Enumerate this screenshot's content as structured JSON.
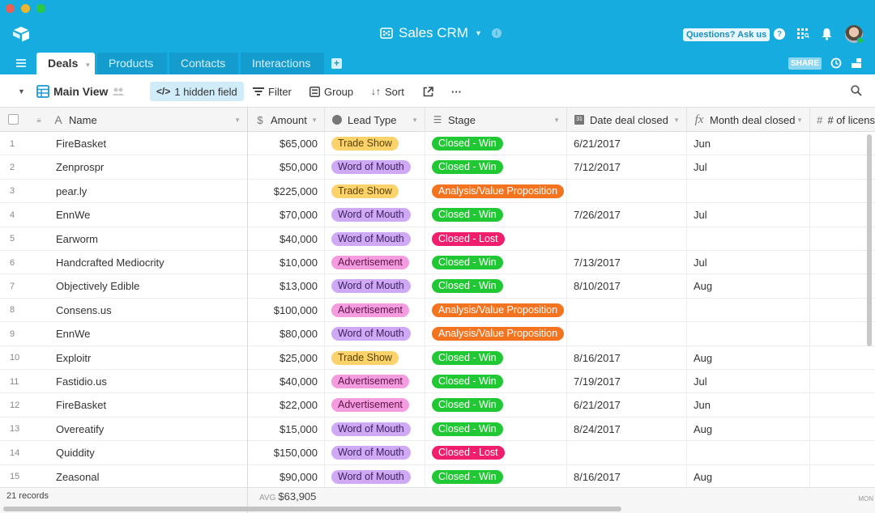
{
  "app": {
    "base_title": "Sales CRM",
    "help_button": "Questions? Ask us",
    "share_button": "SHARE",
    "colors": {
      "brand": "#17ace0",
      "tab_inactive": "#139ccd",
      "hidden_chip": "#d1ecf9"
    }
  },
  "tabs": [
    {
      "label": "Deals",
      "active": true
    },
    {
      "label": "Products",
      "active": false
    },
    {
      "label": "Contacts",
      "active": false
    },
    {
      "label": "Interactions",
      "active": false
    }
  ],
  "toolbar": {
    "view_name": "Main View",
    "hidden_fields": "1 hidden field",
    "filter": "Filter",
    "group": "Group",
    "sort": "Sort",
    "more": "···"
  },
  "columns": {
    "name": "Name",
    "amount": "Amount",
    "lead_type": "Lead Type",
    "stage": "Stage",
    "date_closed": "Date deal closed",
    "month_closed": "Month deal closed",
    "licenses": "# of licens"
  },
  "lead_colors": {
    "Trade Show": {
      "bg": "#fcd26a",
      "fg": "#5a4200"
    },
    "Word of Mouth": {
      "bg": "#cfa9f5",
      "fg": "#3b1f5c"
    },
    "Advertisement": {
      "bg": "#f59be0",
      "fg": "#5c1449"
    }
  },
  "stage_colors": {
    "Closed - Win": {
      "bg": "#20c933",
      "fg": "#ffffff"
    },
    "Closed - Lost": {
      "bg": "#f01e6c",
      "fg": "#ffffff"
    },
    "Analysis/Value Proposition": {
      "bg": "#f4731e",
      "fg": "#ffffff"
    }
  },
  "rows": [
    {
      "num": "1",
      "name": "FireBasket",
      "amount": "$65,000",
      "lead": "Trade Show",
      "stage": "Closed - Win",
      "date": "6/21/2017",
      "month": "Jun"
    },
    {
      "num": "2",
      "name": "Zenprospr",
      "amount": "$50,000",
      "lead": "Word of Mouth",
      "stage": "Closed - Win",
      "date": "7/12/2017",
      "month": "Jul"
    },
    {
      "num": "3",
      "name": "pear.ly",
      "amount": "$225,000",
      "lead": "Trade Show",
      "stage": "Analysis/Value Proposition",
      "date": "",
      "month": ""
    },
    {
      "num": "4",
      "name": "EnnWe",
      "amount": "$70,000",
      "lead": "Word of Mouth",
      "stage": "Closed - Win",
      "date": "7/26/2017",
      "month": "Jul"
    },
    {
      "num": "5",
      "name": "Earworm",
      "amount": "$40,000",
      "lead": "Word of Mouth",
      "stage": "Closed - Lost",
      "date": "",
      "month": ""
    },
    {
      "num": "6",
      "name": "Handcrafted Mediocrity",
      "amount": "$10,000",
      "lead": "Advertisement",
      "stage": "Closed - Win",
      "date": "7/13/2017",
      "month": "Jul"
    },
    {
      "num": "7",
      "name": "Objectively Edible",
      "amount": "$13,000",
      "lead": "Word of Mouth",
      "stage": "Closed - Win",
      "date": "8/10/2017",
      "month": "Aug"
    },
    {
      "num": "8",
      "name": "Consens.us",
      "amount": "$100,000",
      "lead": "Advertisement",
      "stage": "Analysis/Value Proposition",
      "date": "",
      "month": ""
    },
    {
      "num": "9",
      "name": "EnnWe",
      "amount": "$80,000",
      "lead": "Word of Mouth",
      "stage": "Analysis/Value Proposition",
      "date": "",
      "month": ""
    },
    {
      "num": "10",
      "name": "Exploitr",
      "amount": "$25,000",
      "lead": "Trade Show",
      "stage": "Closed - Win",
      "date": "8/16/2017",
      "month": "Aug"
    },
    {
      "num": "11",
      "name": "Fastidio.us",
      "amount": "$40,000",
      "lead": "Advertisement",
      "stage": "Closed - Win",
      "date": "7/19/2017",
      "month": "Jul"
    },
    {
      "num": "12",
      "name": "FireBasket",
      "amount": "$22,000",
      "lead": "Advertisement",
      "stage": "Closed - Win",
      "date": "6/21/2017",
      "month": "Jun"
    },
    {
      "num": "13",
      "name": "Overeatify",
      "amount": "$15,000",
      "lead": "Word of Mouth",
      "stage": "Closed - Win",
      "date": "8/24/2017",
      "month": "Aug"
    },
    {
      "num": "14",
      "name": "Quiddity",
      "amount": "$150,000",
      "lead": "Word of Mouth",
      "stage": "Closed - Lost",
      "date": "",
      "month": ""
    },
    {
      "num": "15",
      "name": "Zeasonal",
      "amount": "$90,000",
      "lead": "Word of Mouth",
      "stage": "Closed - Win",
      "date": "8/16/2017",
      "month": "Aug"
    }
  ],
  "footer": {
    "records": "21 records",
    "avg_label": "AVG",
    "avg_value": "$63,905",
    "month_summary": "MON"
  }
}
